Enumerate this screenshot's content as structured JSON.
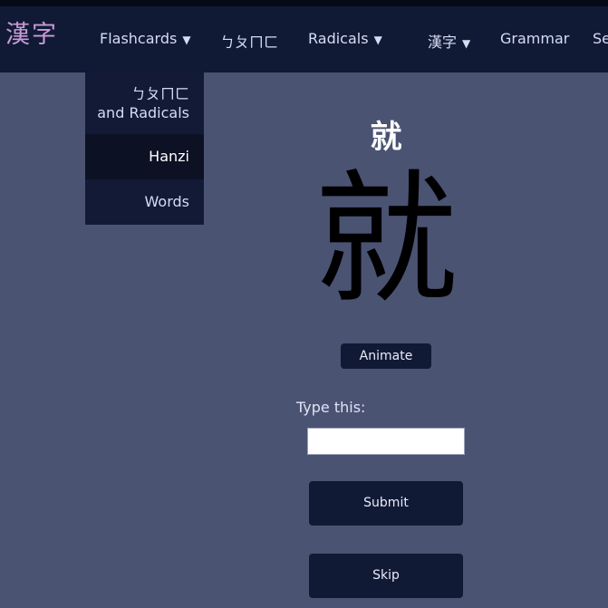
{
  "logo": "漢字",
  "nav": {
    "items": [
      {
        "label": "Flashcards",
        "caret": "▼"
      },
      {
        "label": "ㄅㄆㄇㄈ",
        "caret": ""
      },
      {
        "label": "Radicals",
        "caret": "▼"
      },
      {
        "label": "漢字",
        "caret": "▼"
      },
      {
        "label": "Grammar",
        "caret": ""
      },
      {
        "label": "Se",
        "caret": ""
      }
    ]
  },
  "dropdown": {
    "items": [
      {
        "line1": "ㄅㄆㄇㄈ",
        "line2": "and Radicals"
      },
      {
        "label": "Hanzi",
        "active": true
      },
      {
        "label": "Words"
      }
    ]
  },
  "card": {
    "title": "就",
    "character": "就"
  },
  "buttons": {
    "animate": "Animate",
    "submit": "Submit",
    "skip": "Skip"
  },
  "prompt": {
    "label": "Type this:",
    "value": ""
  }
}
